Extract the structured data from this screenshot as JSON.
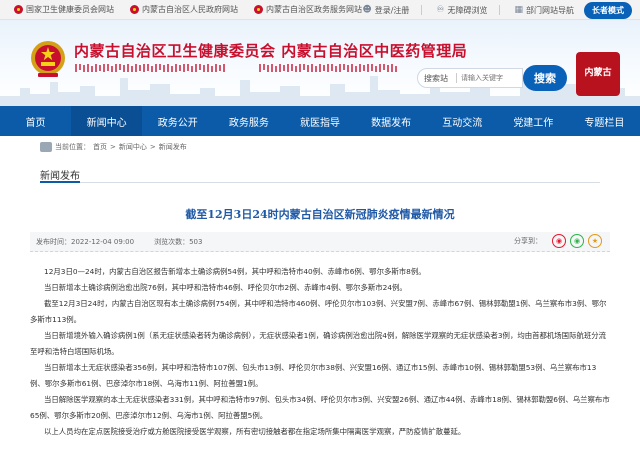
{
  "topbar": {
    "links": [
      "国家卫生健康委员会网站",
      "内蒙古自治区人民政府网站",
      "内蒙古自治区政务服务网站"
    ],
    "login": "登录/注册",
    "accessibility": "无障碍浏览",
    "navigation": "部门网站导航",
    "elder_mode": "长者模式"
  },
  "header": {
    "title": "内蒙古自治区卫生健康委员会   内蒙古自治区中医药管理局",
    "search_select": "搜索站",
    "search_placeholder": "请输入关键字",
    "search_button": "搜索",
    "seal_text": "内蒙古"
  },
  "nav": {
    "items": [
      "首页",
      "新闻中心",
      "政务公开",
      "政务服务",
      "就医指导",
      "数据发布",
      "互动交流",
      "党建工作",
      "专题栏目"
    ],
    "active_index": 1
  },
  "breadcrumb": {
    "prefix": "当前位置：",
    "items": [
      "首页",
      "新闻中心",
      "新闻发布"
    ]
  },
  "section": {
    "title": "新闻发布"
  },
  "article": {
    "title": "截至12月3日24时内蒙古自治区新冠肺炎疫情最新情况",
    "published": "发布时间：2022-12-04 09:00",
    "views": "浏览次数：503",
    "share_label": "分享到：",
    "paragraphs": [
      "12月3日0—24时，内蒙古自治区报告新增本土确诊病例54例，其中呼和浩特市40例、赤峰市6例、鄂尔多斯市8例。",
      "当日新增本土确诊病例治愈出院76例，其中呼和浩特市46例、呼伦贝尔市2例、赤峰市4例、鄂尔多斯市24例。",
      "截至12月3日24时，内蒙古自治区现有本土确诊病例754例，其中呼和浩特市460例、呼伦贝尔市103例、兴安盟7例、赤峰市67例、锡林郭勒盟1例、乌兰察布市3例、鄂尔多斯市113例。",
      "当日新增境外输入确诊病例1例（系无症状感染者转为确诊病例），无症状感染者1例，确诊病例治愈出院4例，解除医学观察的无症状感染者3例，均由首都机场国际航班分流至呼和浩特白塔国际机场。",
      "当日新增本土无症状感染者356例，其中呼和浩特市107例、包头市13例、呼伦贝尔市38例、兴安盟16例、通辽市15例、赤峰市10例、锡林郭勒盟53例、乌兰察布市13例、鄂尔多斯市61例、巴彦淖尔市18例、乌海市11例、阿拉善盟1例。",
      "当日解除医学观察的本土无症状感染者331例，其中呼和浩特市97例、包头市34例、呼伦贝尔市3例、兴安盟26例、通辽市44例、赤峰市18例、锡林郭勒盟6例、乌兰察布市65例、鄂尔多斯市20例、巴彦淖尔市12例、乌海市1例、阿拉善盟5例。",
      "以上人员均在定点医院接受治疗或方舱医院接受医学观察，所有密切接触者都在指定场所集中隔离医学观察，严防疫情扩散蔓延。"
    ]
  },
  "colors": {
    "brand_red": "#c8102e",
    "nav_blue": "#0b5ba8",
    "title_blue": "#1f59a6"
  }
}
